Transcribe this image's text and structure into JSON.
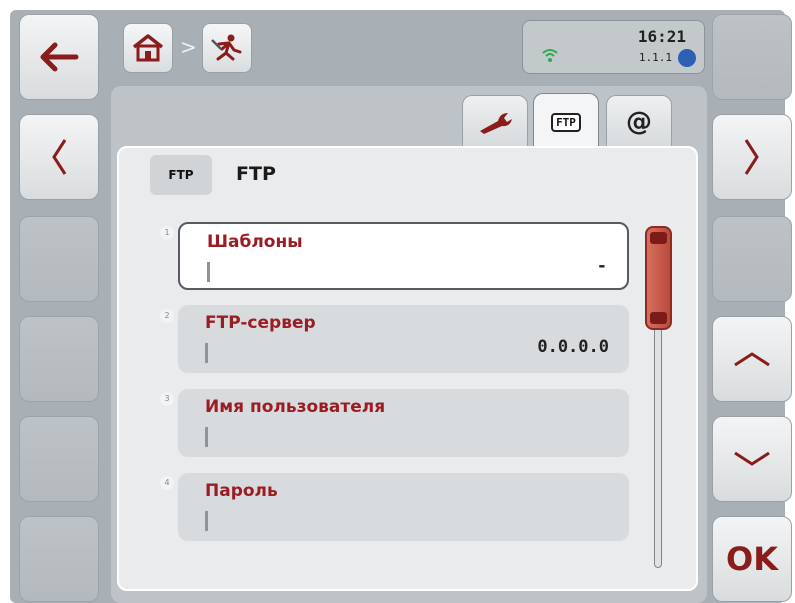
{
  "status": {
    "time": "16:21",
    "version": "1.1.1"
  },
  "tabs": [
    {
      "icon": "wrench-icon",
      "label": ""
    },
    {
      "icon": "ftp-icon",
      "label": "FTP"
    },
    {
      "icon": "at-icon",
      "label": "@"
    }
  ],
  "panel": {
    "badge": "FTP",
    "title": "FTP"
  },
  "fields": [
    {
      "num": "1",
      "label": "Шаблоны",
      "value": "-"
    },
    {
      "num": "2",
      "label": "FTP-сервер",
      "value": "0.0.0.0"
    },
    {
      "num": "3",
      "label": "Имя пользователя",
      "value": ""
    },
    {
      "num": "4",
      "label": "Пароль",
      "value": ""
    }
  ],
  "softkeys": {
    "ok_label": "OK"
  },
  "colors": {
    "accent": "#9b1c22",
    "frame": "#a9b0b5"
  }
}
